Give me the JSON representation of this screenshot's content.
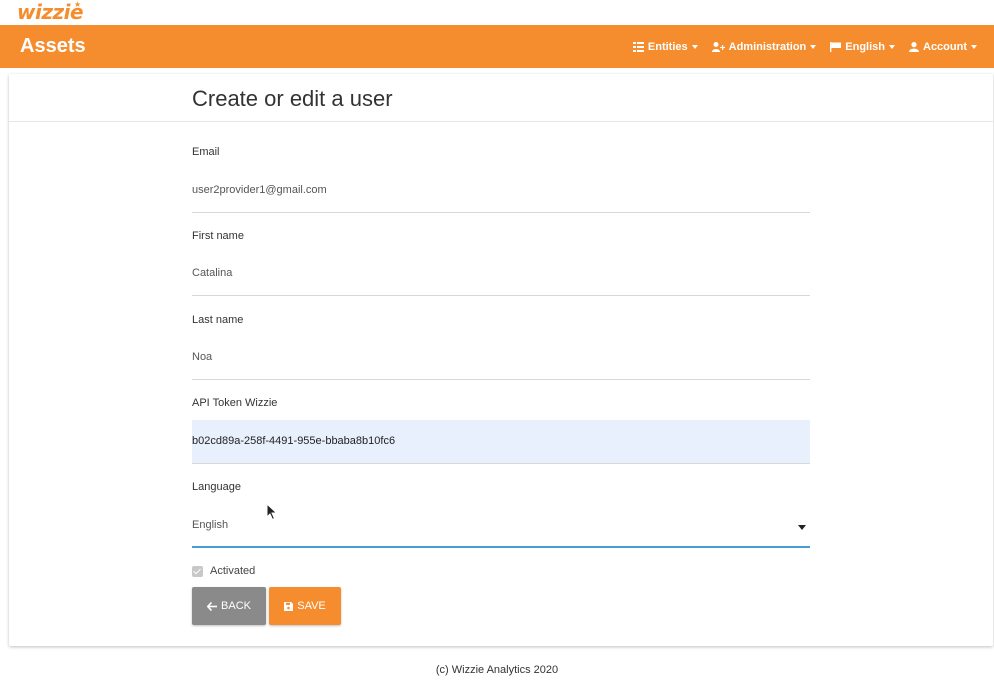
{
  "logo": {
    "text": "wizzie"
  },
  "navbar": {
    "brand": "Assets",
    "items": [
      {
        "label": "Entities",
        "icon": "list-icon"
      },
      {
        "label": "Administration",
        "icon": "user-plus-icon"
      },
      {
        "label": "English",
        "icon": "flag-icon"
      },
      {
        "label": "Account",
        "icon": "user-icon"
      }
    ]
  },
  "form": {
    "title": "Create or edit a user",
    "email": {
      "label": "Email",
      "value": "user2provider1@gmail.com"
    },
    "first_name": {
      "label": "First name",
      "value": "Catalina"
    },
    "last_name": {
      "label": "Last name",
      "value": "Noa"
    },
    "api_token": {
      "label": "API Token Wizzie",
      "value": "b02cd89a-258f-4491-955e-bbaba8b10fc6"
    },
    "language": {
      "label": "Language",
      "value": "English"
    },
    "activated": {
      "label": "Activated",
      "checked": true
    },
    "back_label": "BACK",
    "save_label": "SAVE"
  },
  "footer": {
    "text": "(c) Wizzie Analytics 2020"
  },
  "colors": {
    "brand": "#f58d2e",
    "back_button": "#8a8a8a",
    "focus": "#4a9bd0"
  }
}
